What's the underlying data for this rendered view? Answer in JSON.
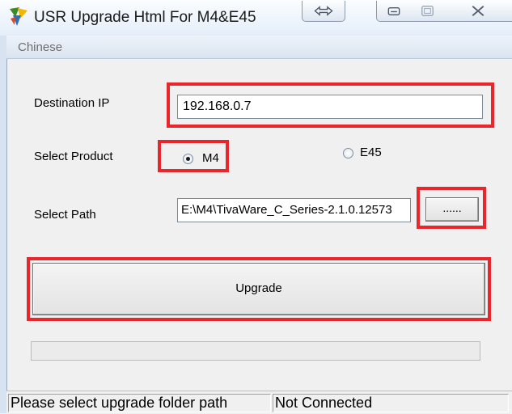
{
  "window": {
    "title": "USR Upgrade Html For M4&E45",
    "icons": [
      "app-icon",
      "restore-icon",
      "minimize-icon",
      "maximize-icon",
      "close-icon"
    ]
  },
  "menu": {
    "items": [
      {
        "label": "Chinese"
      }
    ]
  },
  "form": {
    "ip_label": "Destination IP",
    "ip_value": "192.168.0.7",
    "product_label": "Select Product",
    "products": [
      {
        "label": "M4",
        "selected": true
      },
      {
        "label": "E45",
        "selected": false
      }
    ],
    "path_label": "Select Path",
    "path_value": "E:\\M4\\TivaWare_C_Series-2.1.0.12573",
    "browse_label": "......",
    "upgrade_label": "Upgrade",
    "progress": 0
  },
  "status": {
    "message": "Please select upgrade folder path",
    "connection": "Not Connected"
  },
  "colors": {
    "highlight": "#e8262b",
    "title_gradient_top": "#fbfdff",
    "title_gradient_bottom": "#e4eef9"
  }
}
